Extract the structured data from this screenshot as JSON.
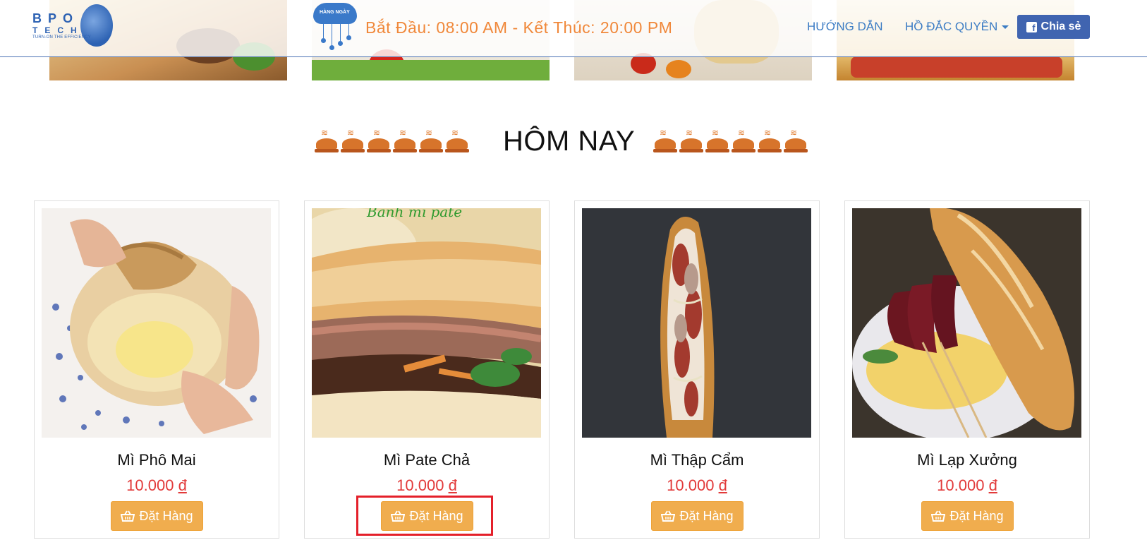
{
  "header": {
    "logo_letters": "BPO",
    "logo_sub": "TECH",
    "logo_tagline": "TURN-ON THE EFFICIENCY",
    "daily_icon_text": "HÀNG NGÀY",
    "hours": "Bắt Đầu: 08:00 AM - Kết Thúc: 20:00 PM",
    "nav_guide": "HƯỚNG DẪN",
    "nav_user": "HỒ ĐẮC QUYỀN",
    "share_button": "Chia sẻ"
  },
  "section": {
    "title": "HÔM NAY"
  },
  "products": [
    {
      "name": "Mì Phô Mai",
      "price": "10.000",
      "currency": "đ",
      "button": "Đặt Hàng"
    },
    {
      "name": "Mì Pate Chả",
      "price": "10.000",
      "currency": "đ",
      "button": "Đặt Hàng"
    },
    {
      "name": "Mì Thập Cẩm",
      "price": "10.000",
      "currency": "đ",
      "button": "Đặt Hàng"
    },
    {
      "name": "Mì Lạp Xưởng",
      "price": "10.000",
      "currency": "đ",
      "button": "Đặt Hàng"
    }
  ],
  "photo_overlay_text": "Bánh mì pate",
  "colors": {
    "accent_orange": "#f0ad4e",
    "price_red": "#e23a3a",
    "nav_blue": "#3c7cc4",
    "facebook_blue": "#4064b0",
    "highlight_red": "#e4202a"
  },
  "icons": [
    "logo-globe-icon",
    "daily-cloud-icon",
    "caret-down-icon",
    "facebook-icon",
    "roast-chicken-icon",
    "basket-icon"
  ]
}
